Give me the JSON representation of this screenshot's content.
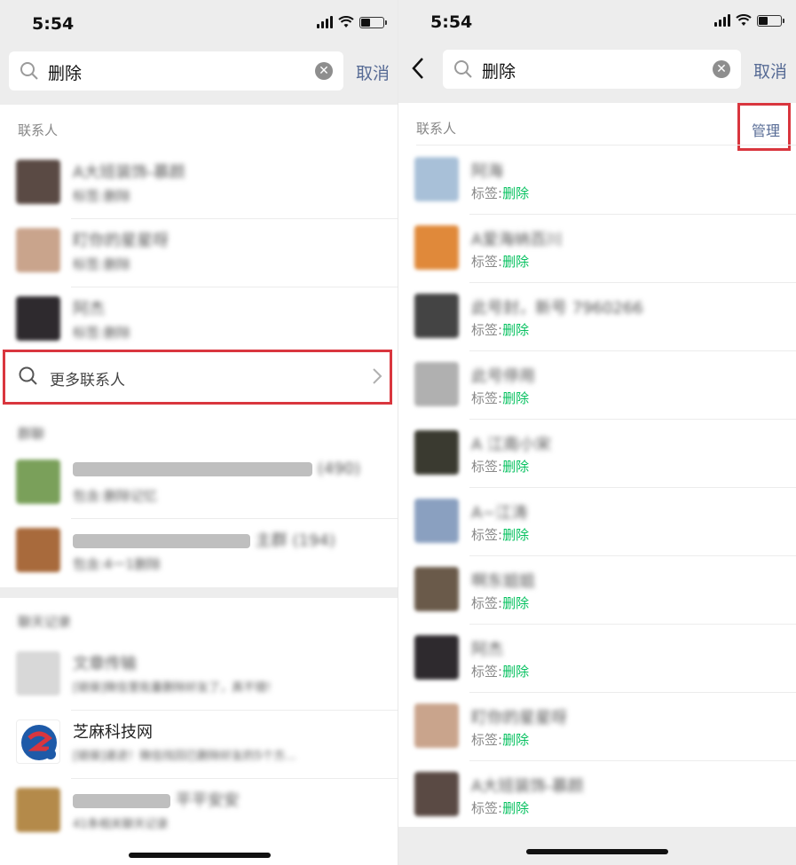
{
  "left": {
    "status": {
      "time": "5:54"
    },
    "search": {
      "query": "删除",
      "cancel": "取消"
    },
    "contacts_section": "联系人",
    "contacts": [
      {
        "name": "A大班装饰-慕颜",
        "sub": "标签:删除",
        "color": "#5a4a44"
      },
      {
        "name": "盯你的星星呀",
        "sub": "标签:删除",
        "color": "#c9a48c"
      },
      {
        "name": "阿杰",
        "sub": "标签:删除",
        "color": "#2e2a2e"
      }
    ],
    "more_contacts": "更多联系人",
    "groups_section": "群聊",
    "groups": [
      {
        "name": "(490)",
        "sub": "包含:删除记忆",
        "color": "#7aa05a"
      },
      {
        "name": "主群 (194)",
        "sub": "包含:4一1删除",
        "color": "#a86a3c"
      }
    ],
    "chats_section": "聊天记录",
    "chats": [
      {
        "name": "文章传输",
        "sub": "[链接]微信里批量删除好友了，真不错!",
        "color": "#8a7a6a",
        "blurred": true
      },
      {
        "name": "芝麻科技网",
        "sub": "[链接]速进！微信找回已删除好友的5个方...",
        "color": "#1e5aa8",
        "blurred": false
      },
      {
        "name": "平平安安",
        "sub": "41条相关聊天记录",
        "color": "#b48a4a",
        "blurred": true
      }
    ]
  },
  "right": {
    "status": {
      "time": "5:54"
    },
    "search": {
      "query": "删除",
      "cancel": "取消"
    },
    "contacts_section": "联系人",
    "manage": "管理",
    "tag_prefix": "标签:",
    "tag_value": "删除",
    "contacts": [
      {
        "name": "阿海",
        "color": "#a8c0d8"
      },
      {
        "name": "A爱海纳百川",
        "color": "#e0893a"
      },
      {
        "name": "此号封，新号 7960266",
        "color": "#444444"
      },
      {
        "name": "此号停用",
        "color": "#b0b0b0"
      },
      {
        "name": "A 江南小宋",
        "color": "#3a3a30"
      },
      {
        "name": "A~江涛",
        "color": "#8aa0c0"
      },
      {
        "name": "啊东姐姐",
        "color": "#6a5a4a"
      },
      {
        "name": "阿杰",
        "color": "#2e2a2e"
      },
      {
        "name": "盯你的星星呀",
        "color": "#c9a48c"
      },
      {
        "name": "A大班装饰-慕颜",
        "color": "#5a4a44"
      }
    ]
  }
}
